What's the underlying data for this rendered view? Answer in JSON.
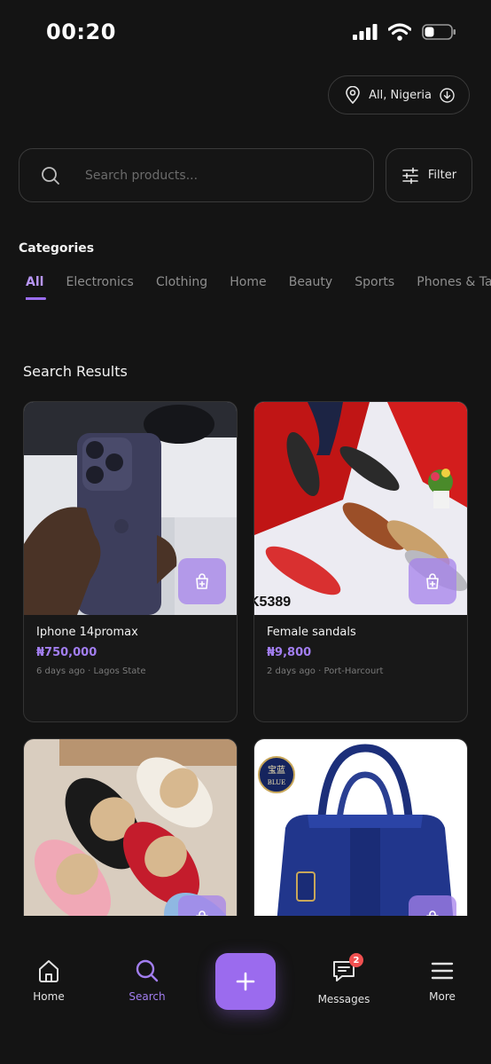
{
  "status_bar": {
    "time": "00:20"
  },
  "location": {
    "label": "All, Nigeria"
  },
  "search": {
    "placeholder": "Search products...",
    "filter_label": "Filter"
  },
  "categories": {
    "title": "Categories",
    "items": [
      {
        "label": "All",
        "active": true
      },
      {
        "label": "Electronics"
      },
      {
        "label": "Clothing"
      },
      {
        "label": "Home"
      },
      {
        "label": "Beauty"
      },
      {
        "label": "Sports"
      },
      {
        "label": "Phones & Tablets"
      }
    ]
  },
  "results": {
    "title": "Search Results",
    "products": [
      {
        "name": "Iphone 14promax",
        "price": "₦750,000",
        "meta": "6 days ago · Lagos State"
      },
      {
        "name": "Female sandals",
        "price": "₦9,800",
        "meta": "2 days ago · Port-Harcourt",
        "image_text": "K5389"
      },
      {
        "name": "",
        "price": "",
        "meta": ""
      },
      {
        "name": "",
        "price": "",
        "meta": "",
        "image_text": "宝蓝 BLUE"
      }
    ]
  },
  "bottom_nav": {
    "home": "Home",
    "search": "Search",
    "messages": "Messages",
    "messages_badge": "2",
    "more": "More"
  },
  "colors": {
    "accent": "#9b6bee",
    "background": "#141414",
    "badge": "#f05050"
  }
}
